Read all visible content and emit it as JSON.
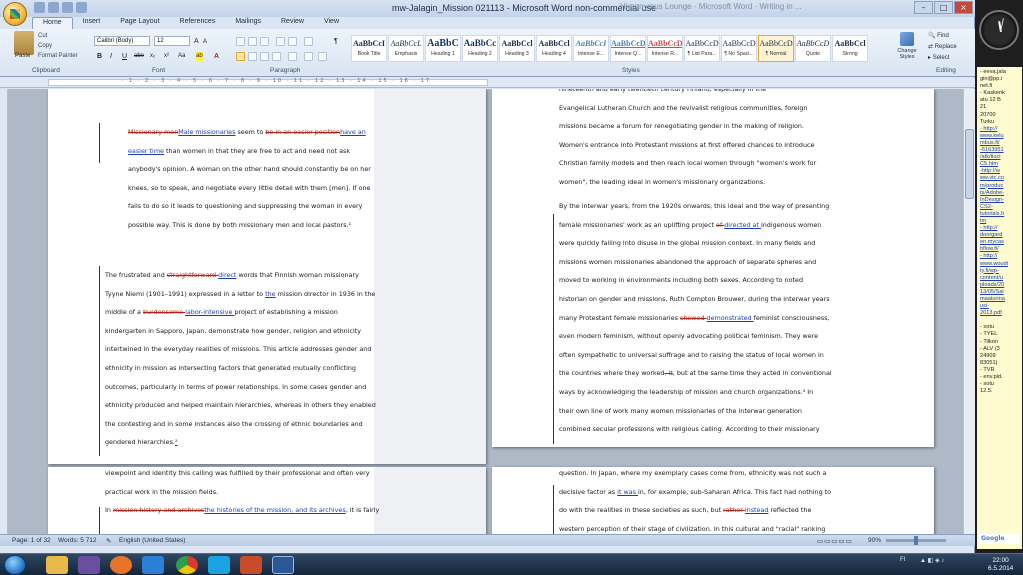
{
  "window": {
    "title": "mw-Jalagin_Mission 021113 - Microsoft Word non-commercial use",
    "ghost_tabs": "Hieronymus Lounge  ·  Microsoft Word  ·  Writing in ...",
    "controls": {
      "minimize": "–",
      "maximize": "□",
      "close": "×"
    }
  },
  "ribbon": {
    "tabs": [
      "Home",
      "Insert",
      "Page Layout",
      "References",
      "Mailings",
      "Review",
      "View"
    ],
    "clipboard": {
      "paste": "Paste",
      "cut": "Cut",
      "copy": "Copy",
      "format_painter": "Format Painter",
      "label": "Clipboard"
    },
    "font": {
      "family": "Calibri (Body)",
      "size": "12",
      "label": "Font",
      "bold": "B",
      "italic": "I",
      "underline": "U",
      "grow": "A",
      "shrink": "A",
      "strike": "abe",
      "sub": "x₂",
      "sup": "x²",
      "case": "Aa",
      "highlight": "ab",
      "color": "A"
    },
    "paragraph": {
      "label": "Paragraph",
      "pilcrow": "¶"
    },
    "styles": {
      "label": "Styles",
      "items": [
        {
          "preview": "AaBbCcI",
          "name": "Book Title"
        },
        {
          "preview": "AaBbCcL",
          "name": "Emphasis"
        },
        {
          "preview": "AaBbC",
          "name": "Heading 1"
        },
        {
          "preview": "AaBbCc",
          "name": "Heading 2"
        },
        {
          "preview": "AaBbCcl",
          "name": "Heading 3"
        },
        {
          "preview": "AaBbCcl",
          "name": "Heading 4"
        },
        {
          "preview": "AaBbCcI",
          "name": "Intense E..."
        },
        {
          "preview": "AaBbCcD",
          "name": "Intense Q..."
        },
        {
          "preview": "AaBbCcD",
          "name": "Intense R..."
        },
        {
          "preview": "AaBbCcD",
          "name": "¶ List Para..."
        },
        {
          "preview": "AaBbCcD",
          "name": "¶ No Spaci..."
        },
        {
          "preview": "AaBbCcD",
          "name": "¶ Normal"
        },
        {
          "preview": "AaBbCcD",
          "name": "Quote"
        },
        {
          "preview": "AaBbCcl",
          "name": "Strong"
        }
      ],
      "change_styles": "Change Styles"
    },
    "editing": {
      "find": "Find",
      "replace": "Replace",
      "select": "Select",
      "label": "Editing"
    }
  },
  "ruler": {
    "ticks": "· 1 · 2 · 3 · 4 · 5 · 6 · 7 · 8 · 9 · 10 · 11 · 12 · 13 · 14 · 15 · 16 · 17"
  },
  "document": {
    "page1": {
      "quote": [
        [
          {
            "t": "Missionary men",
            "s": "del"
          },
          {
            "t": "Male missionaries",
            "s": "ins"
          },
          {
            "t": " seem to "
          },
          {
            "t": "be in an easier position",
            "s": "del"
          },
          {
            "t": "have an",
            "s": "ins"
          }
        ],
        [
          {
            "t": "easier time",
            "s": "ins"
          },
          {
            "t": " than women in that they are free to act and need not ask"
          }
        ],
        [
          {
            "t": "anybody's opinion.  A woman on the other hand should constantly be on her"
          }
        ],
        [
          {
            "t": "knees, so to speak, and negotiate every little detail with them [men].  If one"
          }
        ],
        [
          {
            "t": "fails to do so it leads to questioning and suppressing the woman in every"
          }
        ],
        [
          {
            "t": "possible way. This is done by both missionary men and local pastors.¹"
          }
        ]
      ],
      "body": [
        [
          {
            "t": "The frustrated and "
          },
          {
            "t": "straightforward ",
            "s": "del"
          },
          {
            "t": "direct",
            "s": "ins"
          },
          {
            "t": " words that Finnish woman missionary"
          }
        ],
        [
          {
            "t": "Tyyne Niemi (1901–1991) expressed in a letter to "
          },
          {
            "t": "the",
            "s": "ins"
          },
          {
            "t": " mission director in 1936 in the"
          }
        ],
        [
          {
            "t": "middle of a "
          },
          {
            "t": "burdensome ",
            "s": "del"
          },
          {
            "t": "labor-intensive ",
            "s": "ins"
          },
          {
            "t": "project of establishing a mission"
          }
        ],
        [
          {
            "t": "kindergarten in Sapporo, Japan, demonstrate how gender, religion and ethnicity"
          }
        ],
        [
          {
            "t": "intertwined in the everyday realities of missions. This article addresses gender and"
          }
        ],
        [
          {
            "t": "ethnicity in mission as intersecting factors that generated mutually conflicting"
          }
        ],
        [
          {
            "t": "outcomes, particularly in terms of power relationships.  In some cases gender and"
          }
        ],
        [
          {
            "t": "ethnicity produced and helped maintain hierarchies, whereas in others they enabled"
          }
        ],
        [
          {
            "t": "the contesting and in some instances also the crossing of ethnic boundaries and"
          }
        ],
        [
          {
            "t": "gendered hierarchies."
          },
          {
            "t": "²",
            "s": "ins"
          }
        ]
      ]
    },
    "page2": {
      "para1": [
        [
          {
            "t": "nineteenth and early twentieth century Finland, especially in the"
          }
        ],
        [
          {
            "t": "Evangelical Lutheran Church and the revivalist religious communities, foreign"
          }
        ],
        [
          {
            "t": "missions became a forum for renegotiating gender in the making of religion."
          }
        ],
        [
          {
            "t": "Women's entrance into Protestant missions at first offered chances to introduce"
          }
        ],
        [
          {
            "t": "Christian family models and then reach local women through \"women's work for"
          }
        ],
        [
          {
            "t": "women\", the leading ideal in women's missionary organizations."
          }
        ]
      ],
      "para2": [
        [
          {
            "t": "By the interwar years, from the 1920s onwards, this ideal and the way of presenting"
          }
        ],
        [
          {
            "t": "female missionaries' work as an uplifting project "
          },
          {
            "t": "of ",
            "s": "del"
          },
          {
            "t": "directed at ",
            "s": "ins"
          },
          {
            "t": "indigenous women"
          }
        ],
        [
          {
            "t": "were quickly falling into disuse in the global mission context. In many fields and"
          }
        ],
        [
          {
            "t": "missions women missionaries abandoned the approach of separate spheres and"
          }
        ],
        [
          {
            "t": "moved to working in environments including both sexes. According to noted"
          }
        ],
        [
          {
            "t": "historian on gender and missions, Ruth Compton Brouwer, during the interwar years"
          }
        ],
        [
          {
            "t": "many Protestant female missionaries "
          },
          {
            "t": "showed ",
            "s": "del"
          },
          {
            "t": "demonstrated ",
            "s": "ins"
          },
          {
            "t": "feminist consciousness,"
          }
        ],
        [
          {
            "t": "even modern feminism, without openly advocating political feminism. They were"
          }
        ],
        [
          {
            "t": "often sympathetic to universal suffrage and to raising the status of local women in"
          }
        ],
        [
          {
            "t": "the countries where they worked"
          },
          {
            "t": ", it",
            "s": "del"
          },
          {
            "t": ", but at the same time they acted in conventional"
          }
        ],
        [
          {
            "t": "ways by acknowledging the leadership of mission and church organizations.⁴ In"
          }
        ],
        [
          {
            "t": "their own line of work many women missionaries of the interwar generation"
          }
        ],
        [
          {
            "t": "combined secular professions with religious calling. According to their missionary"
          }
        ]
      ]
    },
    "page3": [
      [
        {
          "t": "viewpoint and identity this calling was fulfilled by their professional and often very"
        }
      ],
      [
        {
          "t": "practical work in the mission fields."
        }
      ],
      [
        {
          "t": "In "
        },
        {
          "t": "mission history and archives",
          "s": "del"
        },
        {
          "t": "the histories of the mission, and its archives",
          "s": "ins"
        },
        {
          "t": ", it is fairly"
        }
      ]
    ],
    "page4": [
      [
        {
          "t": "question. In Japan, where my exemplary cases come from, ethnicity was not such a"
        }
      ],
      [
        {
          "t": "decisive factor as "
        },
        {
          "t": "it was ",
          "s": "ins"
        },
        {
          "t": "in, for example, sub-Saharan Africa. This fact had nothing to"
        }
      ],
      [
        {
          "t": "do with the realities in these societies as such, but "
        },
        {
          "t": "rather ",
          "s": "del"
        },
        {
          "t": "instead",
          "s": "ins"
        },
        {
          "t": " reflected the"
        }
      ],
      [
        {
          "t": "western perception of their stage of civilization.  In this cultural and \"racial\" ranking"
        }
      ]
    ]
  },
  "statusbar": {
    "page": "Page: 1 of 32",
    "words": "Words: 5 712",
    "language": "English (United States)",
    "zoom": "90%"
  },
  "gadgets": {
    "notes": [
      {
        "t": "- eeva.jala"
      },
      {
        "t": "gin@pp.i"
      },
      {
        "t": "net.fi"
      },
      {
        "t": "- Kaskenk"
      },
      {
        "t": "atu 12 B"
      },
      {
        "t": "21"
      },
      {
        "t": "  20700"
      },
      {
        "t": "Turku"
      },
      {
        "t": "- http://",
        "l": true
      },
      {
        "t": "www.kelu",
        "l": true
      },
      {
        "t": "mbus.fi/",
        "l": true
      },
      {
        "t": "-6163951",
        "l": true
      },
      {
        "t": "/atk/tiuci",
        "l": true
      },
      {
        "t": "C5.htm",
        "l": true
      },
      {
        "t": "-http://w",
        "l": true
      },
      {
        "t": "ww.vtc.co",
        "l": true
      },
      {
        "t": "m/produc",
        "l": true
      },
      {
        "t": "ts/Adobe-",
        "l": true
      },
      {
        "t": "InDesign-",
        "l": true
      },
      {
        "t": "CS2-",
        "l": true
      },
      {
        "t": "tutorials.h",
        "l": true
      },
      {
        "t": "tm",
        "l": true
      },
      {
        "t": "- http://",
        "l": true
      },
      {
        "t": "doorgard",
        "l": true
      },
      {
        "t": "en.mycas",
        "l": true
      },
      {
        "t": "hflow.fi/",
        "l": true
      },
      {
        "t": "- http://",
        "l": true
      },
      {
        "t": "www.woudi",
        "l": true
      },
      {
        "t": "ty.fi/wp-",
        "l": true
      },
      {
        "t": "content/u",
        "l": true
      },
      {
        "t": "ploads/20",
        "l": true
      },
      {
        "t": "13/05/Sai",
        "l": true
      },
      {
        "t": "maatunna",
        "l": true
      },
      {
        "t": "usi-",
        "l": true
      },
      {
        "t": "2013.pdf",
        "l": true
      },
      {
        "t": ""
      },
      {
        "t": "- sotu"
      },
      {
        "t": "- TYEL"
      },
      {
        "t": "- Tilkon"
      },
      {
        "t": "- ALV  (3"
      },
      {
        "t": "24909"
      },
      {
        "t": "83051)"
      },
      {
        "t": "- TVR"
      },
      {
        "t": "- env.pid."
      },
      {
        "t": "- sotu"
      },
      {
        "t": "12.5."
      }
    ],
    "search_placeholder": "Google"
  },
  "taskbar": {
    "tray_lang": "FI",
    "time": "22:00",
    "date": "6.5.2014"
  }
}
